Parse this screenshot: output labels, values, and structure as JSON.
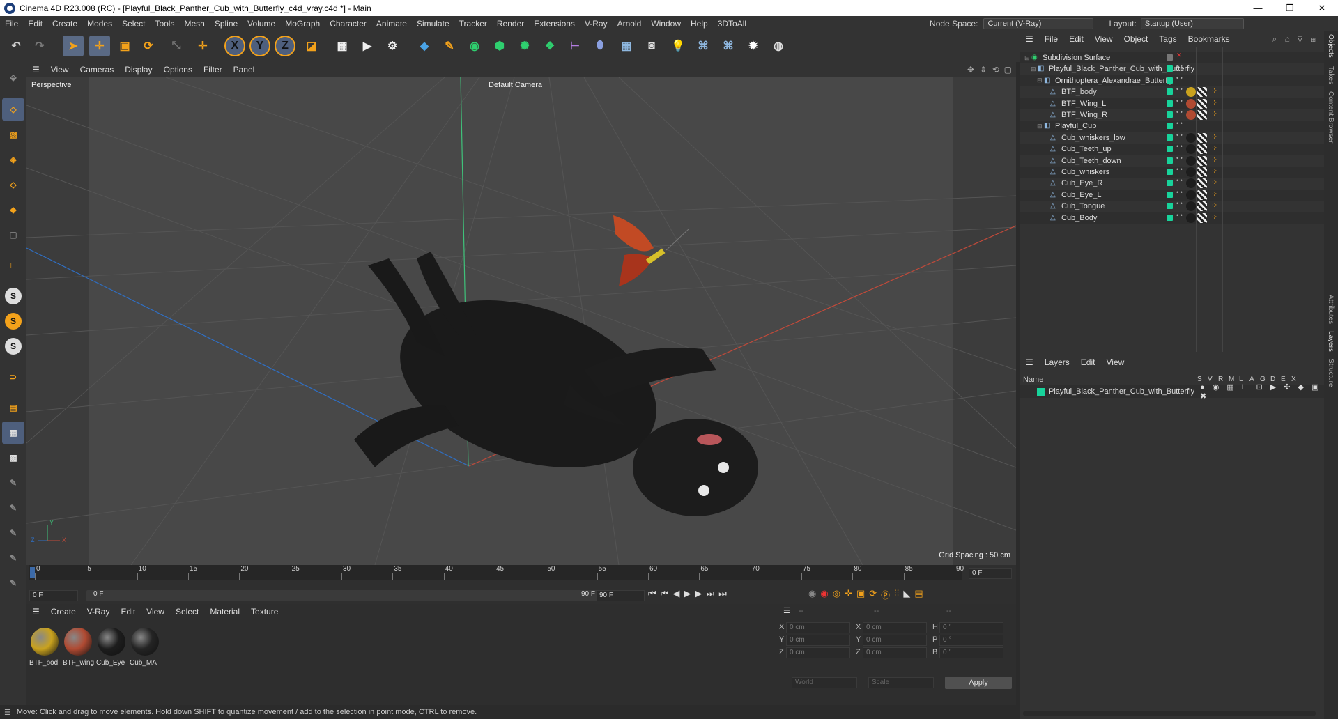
{
  "window": {
    "title": "Cinema 4D R23.008 (RC) - [Playful_Black_Panther_Cub_with_Butterfly_c4d_vray.c4d *] - Main",
    "min": "—",
    "max": "❐",
    "close": "✕"
  },
  "menu": [
    "File",
    "Edit",
    "Create",
    "Modes",
    "Select",
    "Tools",
    "Mesh",
    "Spline",
    "Volume",
    "MoGraph",
    "Character",
    "Animate",
    "Simulate",
    "Tracker",
    "Render",
    "Extensions",
    "V-Ray",
    "Arnold",
    "Window",
    "Help",
    "3DToAll"
  ],
  "nodespace": {
    "label": "Node Space:",
    "value": "Current (V-Ray)"
  },
  "layout": {
    "label": "Layout:",
    "value": "Startup (User)"
  },
  "viewport_menu": [
    "View",
    "Cameras",
    "Display",
    "Options",
    "Filter",
    "Panel"
  ],
  "viewport": {
    "name": "Perspective",
    "camera": "Default Camera",
    "grid": "Grid Spacing : 50 cm"
  },
  "timeline": {
    "ticks": [
      "0",
      "5",
      "10",
      "15",
      "20",
      "25",
      "30",
      "35",
      "40",
      "45",
      "50",
      "55",
      "60",
      "65",
      "70",
      "75",
      "80",
      "85",
      "90"
    ],
    "current_frame": "0 F",
    "start": "0 F",
    "range_start": "0 F",
    "range_end": "90 F",
    "end": "90 F",
    "right_frame": "0 F"
  },
  "material_menu": [
    "Create",
    "V-Ray",
    "Edit",
    "View",
    "Select",
    "Material",
    "Texture"
  ],
  "materials": [
    {
      "name": "BTF_bod",
      "color": "#c9a21e"
    },
    {
      "name": "BTF_wing",
      "color": "#b04a32"
    },
    {
      "name": "Cub_Eye",
      "color": "#1d1d1d"
    },
    {
      "name": "Cub_MA",
      "color": "#242424"
    }
  ],
  "coords": {
    "headers": [
      "--",
      "--",
      "--"
    ],
    "rows": [
      {
        "a": "X",
        "av": "0 cm",
        "b": "X",
        "bv": "0 cm",
        "c": "H",
        "cv": "0 °"
      },
      {
        "a": "Y",
        "av": "0 cm",
        "b": "Y",
        "bv": "0 cm",
        "c": "P",
        "cv": "0 °"
      },
      {
        "a": "Z",
        "av": "0 cm",
        "b": "Z",
        "bv": "0 cm",
        "c": "B",
        "cv": "0 °"
      }
    ],
    "world": "World",
    "scale": "Scale",
    "apply": "Apply"
  },
  "status": "Move: Click and drag to move elements. Hold down SHIFT to quantize movement / add to the selection in point mode, CTRL to remove.",
  "objects_menu": [
    "File",
    "Edit",
    "View",
    "Object",
    "Tags",
    "Bookmarks"
  ],
  "objects": [
    {
      "name": "Subdivision Surface",
      "indent": 0,
      "tags": 0
    },
    {
      "name": "Playful_Black_Panther_Cub_with_Butterfly",
      "indent": 1,
      "tags": 0
    },
    {
      "name": "Ornithoptera_Alexandrae_Butterfly",
      "indent": 2,
      "tags": 0
    },
    {
      "name": "BTF_body",
      "indent": 3,
      "tags": 1
    },
    {
      "name": "BTF_Wing_L",
      "indent": 3,
      "tags": 2
    },
    {
      "name": "BTF_Wing_R",
      "indent": 3,
      "tags": 2
    },
    {
      "name": "Playful_Cub",
      "indent": 2,
      "tags": 0
    },
    {
      "name": "Cub_whiskers_low",
      "indent": 3,
      "tags": 3
    },
    {
      "name": "Cub_Teeth_up",
      "indent": 3,
      "tags": 3
    },
    {
      "name": "Cub_Teeth_down",
      "indent": 3,
      "tags": 3
    },
    {
      "name": "Cub_whiskers",
      "indent": 3,
      "tags": 3
    },
    {
      "name": "Cub_Eye_R",
      "indent": 3,
      "tags": 3
    },
    {
      "name": "Cub_Eye_L",
      "indent": 3,
      "tags": 3
    },
    {
      "name": "Cub_Tongue",
      "indent": 3,
      "tags": 3
    },
    {
      "name": "Cub_Body",
      "indent": 3,
      "tags": 3
    }
  ],
  "layers_menu": [
    "Layers",
    "Edit",
    "View"
  ],
  "layers_cols": {
    "name": "Name",
    "flags": [
      "S",
      "V",
      "R",
      "M",
      "L",
      "A",
      "G",
      "D",
      "E",
      "X"
    ]
  },
  "layer": {
    "name": "Playful_Black_Panther_Cub_with_Butterfly",
    "color": "#18d39b"
  },
  "side_tabs": {
    "top": [
      "Objects",
      "Takes",
      "Content Browser"
    ],
    "bottom": [
      "Attributes",
      "Layers",
      "Structure"
    ]
  },
  "axis": {
    "x": "X",
    "y": "Y",
    "z": "Z"
  }
}
